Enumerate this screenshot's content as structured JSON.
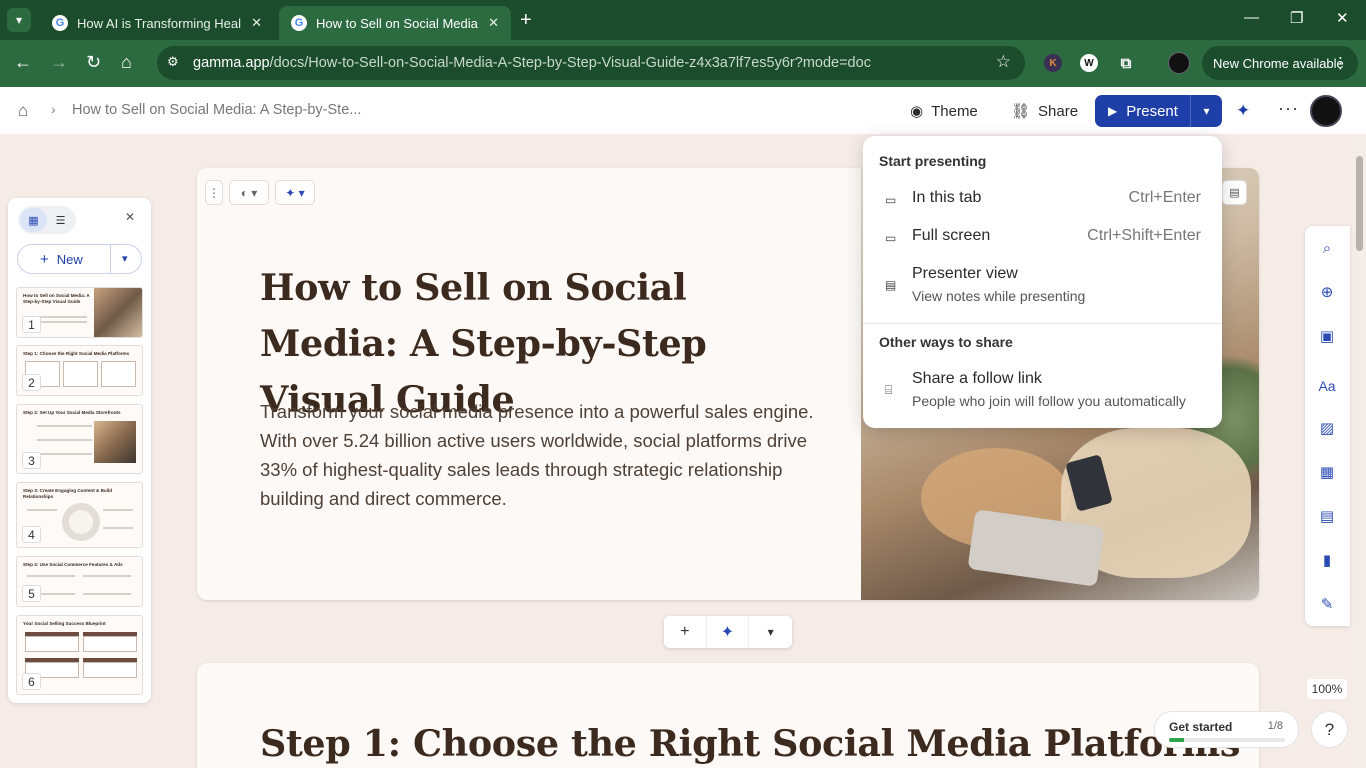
{
  "browser": {
    "tabs": [
      {
        "title": "How AI is Transforming Healthcare",
        "close": "✕"
      },
      {
        "title": "How to Sell on Social Media: A Step-by-Step Visual Guide",
        "close": "✕"
      }
    ],
    "favicon_letter": "G",
    "new_tab": "+",
    "url_host": "gamma.app",
    "url_path": "/docs/How-to-Sell-on-Social-Media-A-Step-by-Step-Visual-Guide-z4x3a7lf7es5y6r?mode=doc",
    "extensions": [
      "K",
      "W"
    ],
    "new_chrome_label": "New Chrome available",
    "window_controls": [
      "—",
      "❐",
      "✕"
    ]
  },
  "app": {
    "breadcrumb": "How to Sell on Social Media: A Step-by-Ste...",
    "theme_label": "Theme",
    "share_label": "Share",
    "present_label": "Present",
    "brand_color": "#1e3fa8"
  },
  "present_menu": {
    "section1": "Start presenting",
    "items": [
      {
        "label": "In this tab",
        "shortcut": "Ctrl+Enter",
        "icon": "tab-icon"
      },
      {
        "label": "Full screen",
        "shortcut": "Ctrl+Shift+Enter",
        "icon": "monitor-icon"
      },
      {
        "label": "Presenter view",
        "sub": "View notes while presenting",
        "icon": "notes-icon"
      }
    ],
    "section2": "Other ways to share",
    "follow": {
      "label": "Share a follow link",
      "sub": "People who join will follow you automatically",
      "icon": "audience-icon"
    }
  },
  "panel": {
    "new_label": "New",
    "slides": [
      {
        "num": "1",
        "title": "How to Sell on Social Media: A Step-by-Step Visual Guide"
      },
      {
        "num": "2",
        "title": "Step 1: Choose the Right Social Media Platforms"
      },
      {
        "num": "3",
        "title": "Step 2: Set Up Your Social Media Storefronts"
      },
      {
        "num": "4",
        "title": "Step 3: Create Engaging Content & Build Relationships"
      },
      {
        "num": "5",
        "title": "Step 4: Use Social Commerce Features & Ads"
      },
      {
        "num": "6",
        "title": "Your Social Selling Success Blueprint"
      }
    ]
  },
  "doc": {
    "title": "How to Sell on Social Media: A Step-by-Step Visual Guide",
    "lede": "Transform your social media presence into a powerful sales engine. With over 5.24 billion active users worldwide, social platforms drive 33% of highest-quality sales leads through strategic relationship building and direct commerce.",
    "next_title": "Step 1: Choose the Right Social Media Platforms"
  },
  "footer": {
    "zoom": "100%",
    "get_started": "Get started",
    "progress_text": "1/8",
    "progress_fraction": 0.125,
    "help": "?"
  }
}
